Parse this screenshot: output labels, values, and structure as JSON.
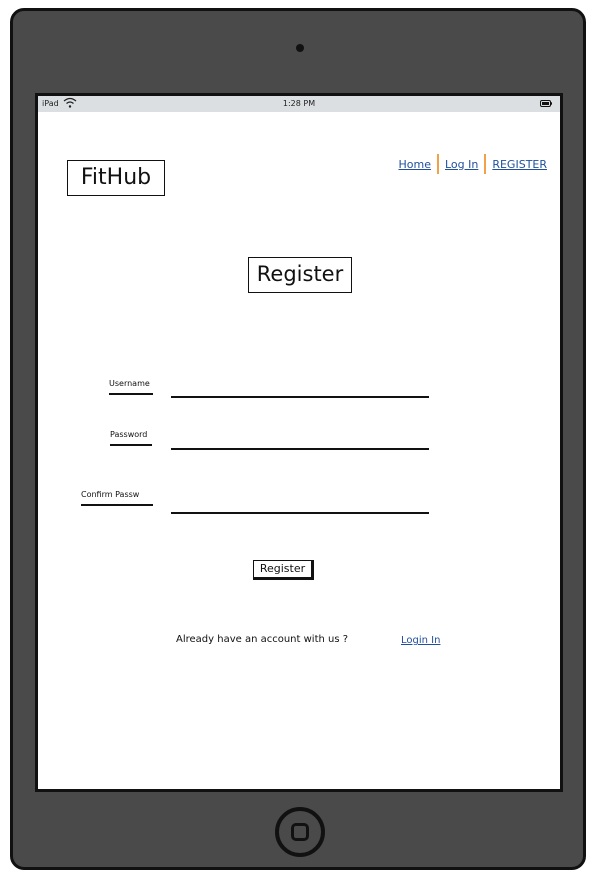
{
  "status_bar": {
    "device": "iPad",
    "time": "1:28 PM"
  },
  "header": {
    "logo": "FitHub",
    "nav": [
      "Home",
      "Log In",
      "REGISTER"
    ]
  },
  "page": {
    "title": "Register"
  },
  "form": {
    "username_label": "Username",
    "password_label": "Password",
    "confirm_label": "Confirm Passw",
    "username_value": "",
    "password_value": "",
    "confirm_value": "",
    "submit_label": "Register"
  },
  "footer": {
    "prompt": "Already have an account with us ?",
    "login_link": "Login In"
  },
  "colors": {
    "device_frame": "#4a4a4a",
    "link": "#1f4f9e",
    "nav_separator": "#f0a24a",
    "status_bar": "#dcdfe2"
  },
  "icons": [
    "wifi-icon",
    "battery-icon",
    "home-button-icon",
    "camera-icon"
  ]
}
